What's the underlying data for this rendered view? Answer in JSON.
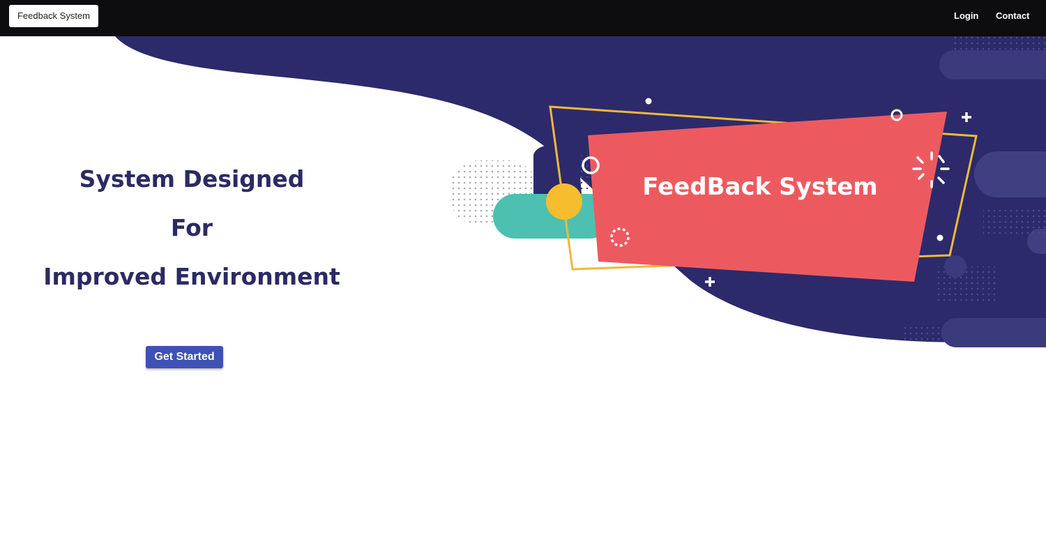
{
  "navbar": {
    "brand_label": "Feedback System",
    "links": [
      {
        "label": "Login"
      },
      {
        "label": "Contact"
      }
    ]
  },
  "hero": {
    "lines": [
      "System Designed",
      "For",
      "Improved Environment"
    ],
    "cta_label": "Get Started",
    "banner_text": "FeedBack System"
  },
  "colors": {
    "navbar_bg": "#0d0c0e",
    "blob": "#2c2a6b",
    "banner": "#ec5a60",
    "frame": "#f0b93a",
    "teal": "#4dc0b1",
    "heading": "#2c2a64",
    "button": "#3f51b5"
  }
}
